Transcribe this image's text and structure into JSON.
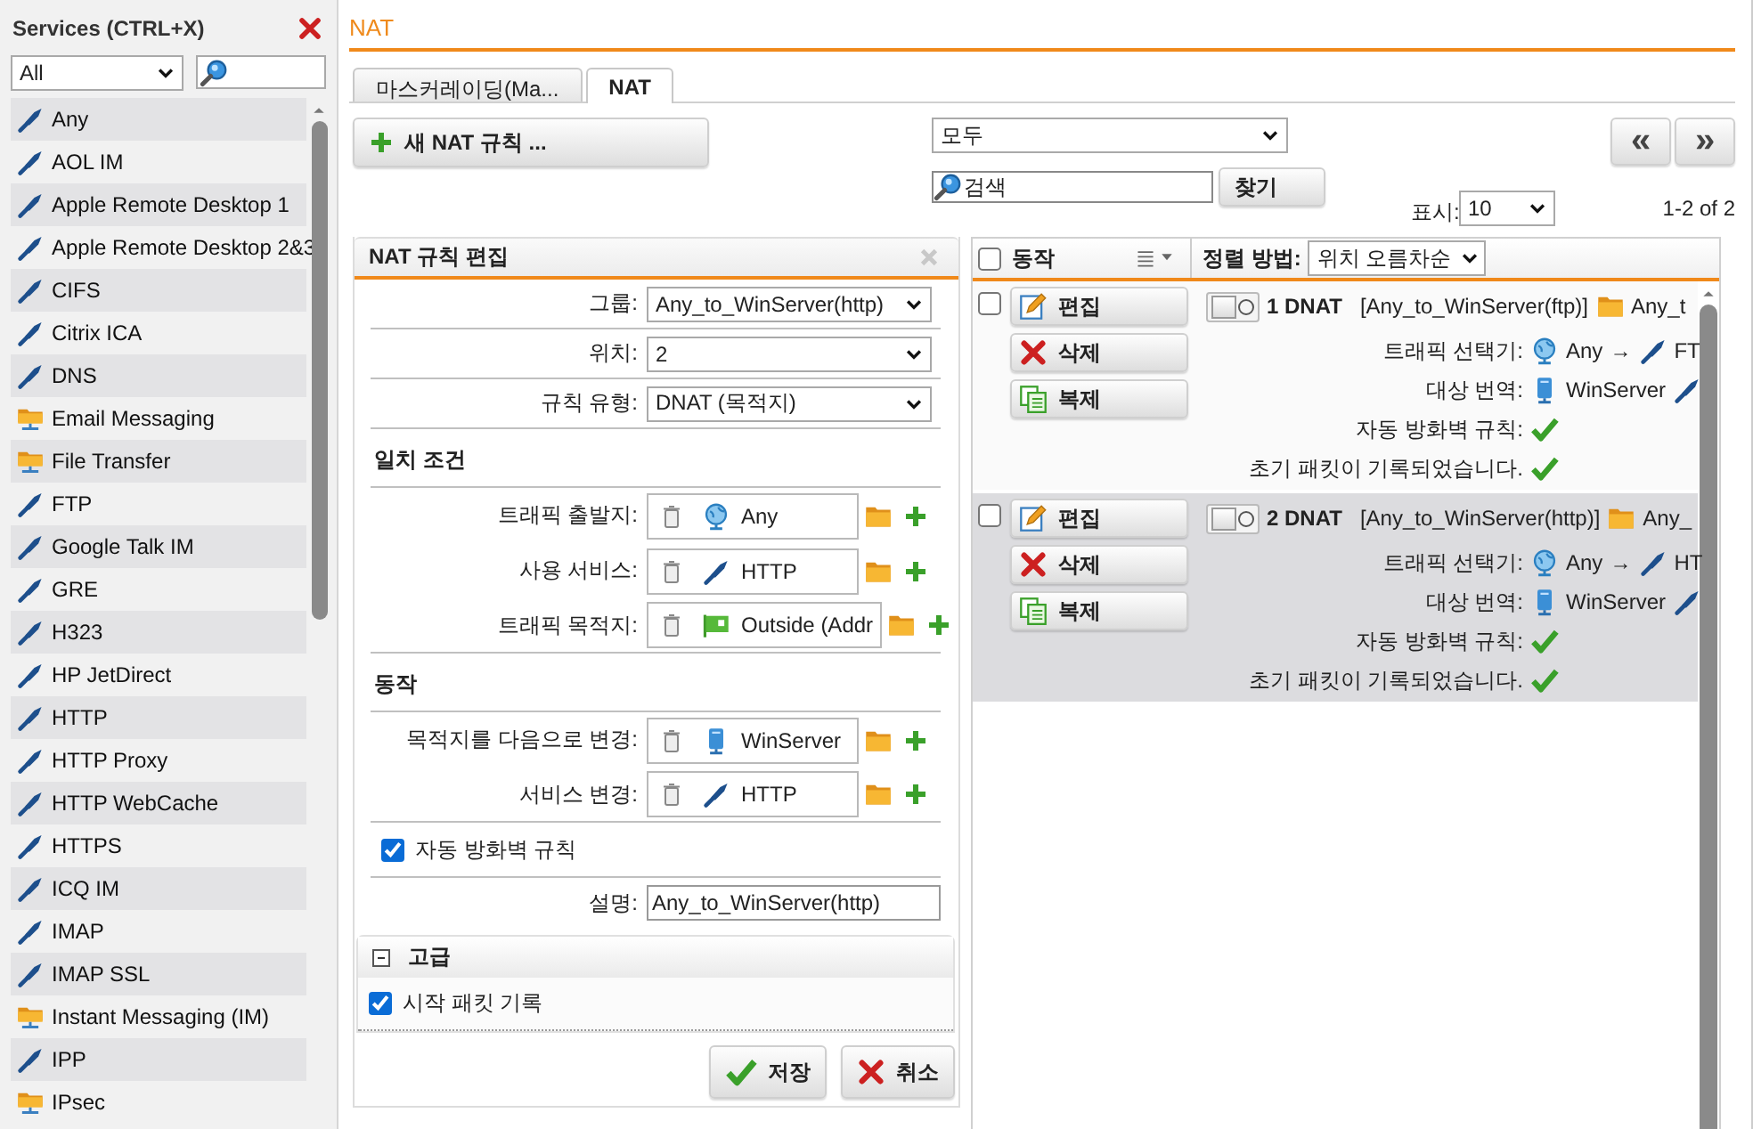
{
  "sidebar": {
    "title": "Services (CTRL+X)",
    "filter": "All",
    "items": [
      {
        "label": "Any",
        "kind": "service"
      },
      {
        "label": "AOL IM",
        "kind": "service"
      },
      {
        "label": "Apple Remote Desktop 1",
        "kind": "service"
      },
      {
        "label": "Apple Remote Desktop 2&3",
        "kind": "service"
      },
      {
        "label": "CIFS",
        "kind": "service"
      },
      {
        "label": "Citrix ICA",
        "kind": "service"
      },
      {
        "label": "DNS",
        "kind": "service"
      },
      {
        "label": "Email Messaging",
        "kind": "group"
      },
      {
        "label": "File Transfer",
        "kind": "group"
      },
      {
        "label": "FTP",
        "kind": "service"
      },
      {
        "label": "Google Talk IM",
        "kind": "service"
      },
      {
        "label": "GRE",
        "kind": "service"
      },
      {
        "label": "H323",
        "kind": "service"
      },
      {
        "label": "HP JetDirect",
        "kind": "service"
      },
      {
        "label": "HTTP",
        "kind": "service"
      },
      {
        "label": "HTTP Proxy",
        "kind": "service"
      },
      {
        "label": "HTTP WebCache",
        "kind": "service"
      },
      {
        "label": "HTTPS",
        "kind": "service"
      },
      {
        "label": "ICQ IM",
        "kind": "service"
      },
      {
        "label": "IMAP",
        "kind": "service"
      },
      {
        "label": "IMAP SSL",
        "kind": "service"
      },
      {
        "label": "Instant Messaging (IM)",
        "kind": "group"
      },
      {
        "label": "IPP",
        "kind": "service"
      },
      {
        "label": "IPsec",
        "kind": "group"
      }
    ]
  },
  "title": "NAT",
  "tabs": [
    {
      "label": "마스커레이딩(Ma...",
      "selected": false
    },
    {
      "label": "NAT",
      "selected": true
    }
  ],
  "toolbar": {
    "new_button": "새 NAT 규칙 ...",
    "filter": "모두",
    "search": "검색",
    "find_button": "찾기",
    "prev": "«",
    "next": "»",
    "show_label": "표시:",
    "page_size": "10",
    "range": "1-2 of 2"
  },
  "editor": {
    "title": "NAT 규칙 편집",
    "rows": [
      {
        "kind": "select",
        "label": "그룹:",
        "value": "Any_to_WinServer(http)"
      },
      {
        "kind": "select",
        "label": "위치:",
        "value": "2"
      },
      {
        "kind": "select",
        "label": "규칙 유형:",
        "value": "DNAT (목적지)"
      },
      {
        "kind": "heading",
        "label": "일치 조건"
      },
      {
        "kind": "object",
        "label": "트래픽 출발지:",
        "object": {
          "kind": "network",
          "value": "Any"
        }
      },
      {
        "kind": "object",
        "label": "사용 서비스:",
        "object": {
          "kind": "service",
          "value": "HTTP"
        }
      },
      {
        "kind": "object",
        "label": "트래픽 목적지:",
        "object": {
          "kind": "interface",
          "value": "Outside (Addr"
        }
      },
      {
        "kind": "heading",
        "label": "동작"
      },
      {
        "kind": "object",
        "label": "목적지를 다음으로 변경:",
        "object": {
          "kind": "host",
          "value": "WinServer"
        }
      },
      {
        "kind": "object",
        "label": "서비스 변경:",
        "object": {
          "kind": "service",
          "value": "HTTP"
        }
      },
      {
        "kind": "checkbox",
        "label": "자동 방화벽 규칙",
        "checked": true
      },
      {
        "kind": "text",
        "label": "설명:",
        "value": "Any_to_WinServer(http)"
      }
    ],
    "advanced": {
      "title": "고급",
      "expanded": true,
      "items": [
        {
          "label": "시작 패킷 기록",
          "checked": true
        }
      ]
    },
    "save": "저장",
    "cancel": "취소"
  },
  "list": {
    "select_all": false,
    "action_label": "동작",
    "sort_label": "정렬 방법:",
    "sort_value": "위치 오름차순",
    "rules": [
      {
        "checked": false,
        "selected": false,
        "enabled": false,
        "buttons": [
          "편집",
          "삭제",
          "복제"
        ],
        "title": "1 DNAT",
        "name": "[Any_to_WinServer(ftp)]",
        "group": "Any_t",
        "details": [
          {
            "kind": "selector",
            "label": "트래픽 선택기:",
            "from": "Any",
            "arrow": "→",
            "to": "FT"
          },
          {
            "kind": "translation",
            "label": "대상 번역:",
            "value": "WinServer"
          },
          {
            "kind": "flag",
            "label": "자동 방화벽 규칙:",
            "on": true
          },
          {
            "kind": "flag",
            "label": "초기 패킷이 기록되었습니다.",
            "on": true
          }
        ]
      },
      {
        "checked": false,
        "selected": true,
        "enabled": false,
        "buttons": [
          "편집",
          "삭제",
          "복제"
        ],
        "title": "2 DNAT",
        "name": "[Any_to_WinServer(http)]",
        "group": "Any_",
        "details": [
          {
            "kind": "selector",
            "label": "트래픽 선택기:",
            "from": "Any",
            "arrow": "→",
            "to": "HT"
          },
          {
            "kind": "translation",
            "label": "대상 번역:",
            "value": "WinServer"
          },
          {
            "kind": "flag",
            "label": "자동 방화벽 규칙:",
            "on": true
          },
          {
            "kind": "flag",
            "label": "초기 패킷이 기록되었습니다.",
            "on": true
          }
        ]
      }
    ]
  }
}
